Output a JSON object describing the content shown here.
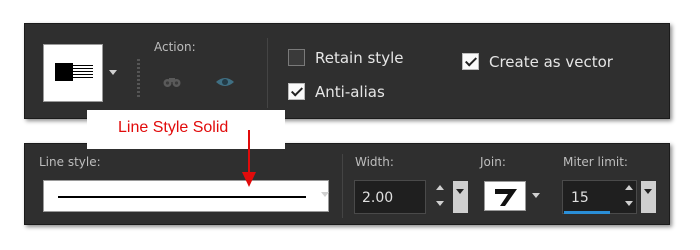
{
  "top_panel": {
    "action_label": "Action:",
    "icons": {
      "binoculars": "binoculars-icon",
      "eye": "eye-icon"
    },
    "retain_style": {
      "label": "Retain style",
      "checked": false
    },
    "anti_alias": {
      "label": "Anti-alias",
      "checked": true
    },
    "create_as_vector": {
      "label": "Create as vector",
      "checked": true
    }
  },
  "annotation": {
    "text": "Line Style Solid",
    "color": "#e10b0b"
  },
  "bottom_panel": {
    "line_style_label": "Line style:",
    "line_style_value": "solid",
    "width_label": "Width:",
    "width_value": "2.00",
    "join_label": "Join:",
    "join_icon": "miter-join-icon",
    "miter_limit_label": "Miter limit:",
    "miter_limit_value": "15"
  },
  "colors": {
    "panel_bg": "#2f2f2f",
    "accent": "#2a8fd8"
  }
}
